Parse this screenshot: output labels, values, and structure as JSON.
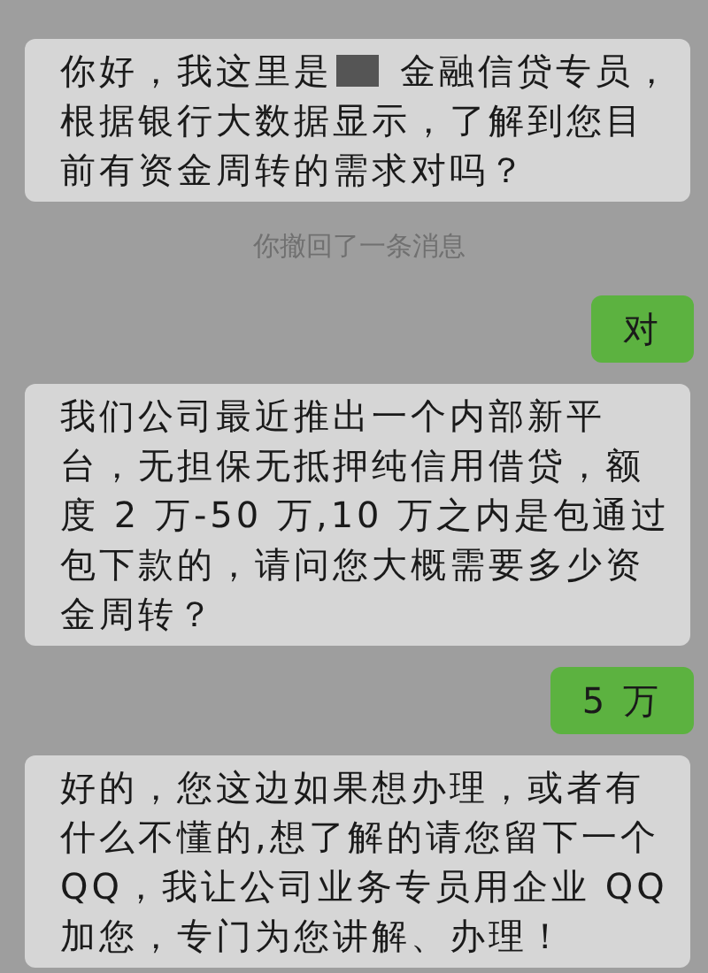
{
  "messages": [
    {
      "kind": "incoming",
      "segments": [
        {
          "kind": "text",
          "text": "你好，我这里是"
        },
        {
          "kind": "redaction"
        },
        {
          "kind": "text",
          "text": "金融信贷专员，"
        },
        {
          "kind": "text",
          "text": "根据银行大数据显示，了解到您目前有资金周转的需求对吗？"
        }
      ]
    },
    {
      "kind": "notice",
      "text": "你撤回了一条消息"
    },
    {
      "kind": "outgoing",
      "segments": [
        {
          "kind": "text",
          "text": "对"
        }
      ]
    },
    {
      "kind": "incoming",
      "segments": [
        {
          "kind": "text",
          "text": "我们公司最近推出一个内部新平台，无担保无抵押纯信用借贷，额度 2 万-50 万,10 万之内是包通过包下款的，请问您大概需要多少资金周转？"
        }
      ]
    },
    {
      "kind": "outgoing",
      "segments": [
        {
          "kind": "text",
          "text": "5 万"
        }
      ]
    },
    {
      "kind": "incoming",
      "segments": [
        {
          "kind": "text",
          "text": "好的，您这边如果想办理，或者有什么不懂的,想了解的请您留下一个 QQ，我让公司业务专员用企业 QQ 加您，专门为您讲解、办理！"
        }
      ]
    }
  ]
}
